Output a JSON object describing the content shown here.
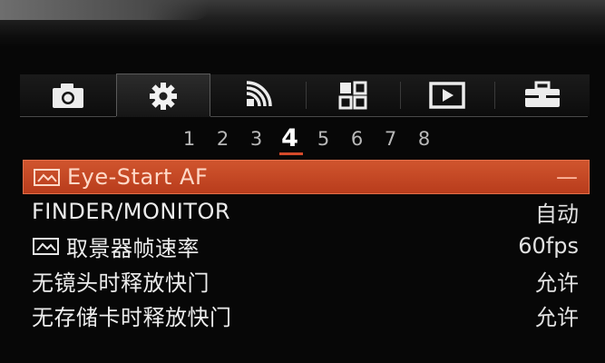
{
  "tabs": [
    {
      "icon": "camera-icon",
      "selected": false
    },
    {
      "icon": "gear-icon",
      "selected": true
    },
    {
      "icon": "wireless-icon",
      "selected": false
    },
    {
      "icon": "grid-icon",
      "selected": false
    },
    {
      "icon": "playback-icon",
      "selected": false
    },
    {
      "icon": "toolbox-icon",
      "selected": false
    }
  ],
  "pages": [
    "1",
    "2",
    "3",
    "4",
    "5",
    "6",
    "7",
    "8"
  ],
  "current_page": "4",
  "menu": {
    "items": [
      {
        "label": "Eye-Start AF",
        "value": "—",
        "icon": "af-frame-icon",
        "highlighted": true
      },
      {
        "label": "FINDER/MONITOR",
        "value": "自动",
        "highlighted": false
      },
      {
        "label": "取景器帧速率",
        "value": "60fps",
        "icon": "af-frame-icon",
        "highlighted": false
      },
      {
        "label": "无镜头时释放快门",
        "value": "允许",
        "highlighted": false
      },
      {
        "label": "无存储卡时释放快门",
        "value": "允许",
        "highlighted": false
      }
    ]
  },
  "colors": {
    "accent": "#c94726",
    "background": "#070707",
    "text": "#e6e6e6"
  }
}
